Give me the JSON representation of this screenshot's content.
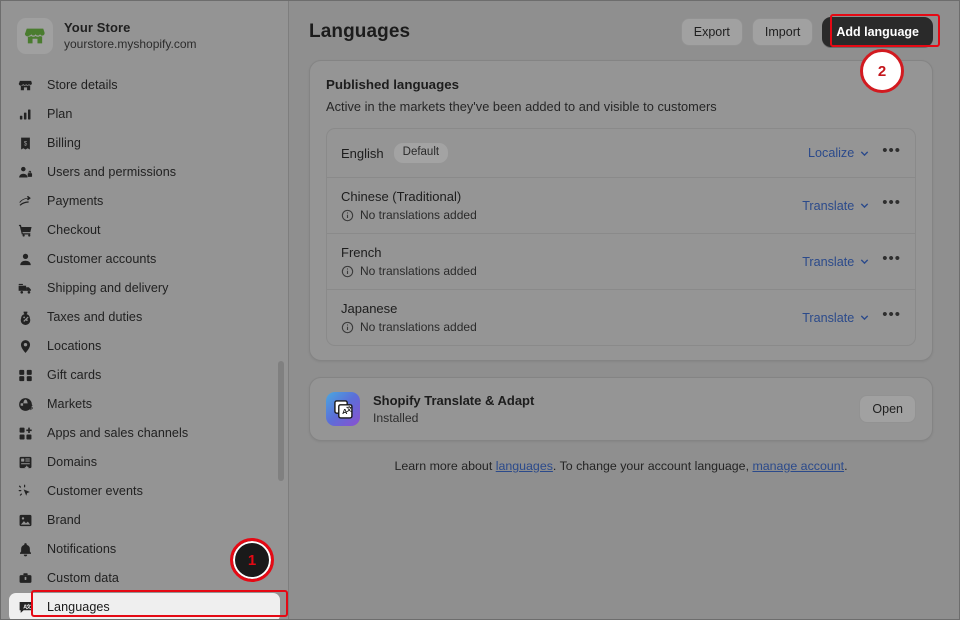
{
  "sidebar": {
    "store": {
      "name": "Your Store",
      "domain": "yourstore.myshopify.com",
      "logo_icon": "storefront-icon"
    },
    "items": [
      {
        "label": "Store details",
        "icon": "storefront-icon",
        "selected": false
      },
      {
        "label": "Plan",
        "icon": "chart-bars-icon",
        "selected": false
      },
      {
        "label": "Billing",
        "icon": "receipt-dollar-icon",
        "selected": false
      },
      {
        "label": "Users and permissions",
        "icon": "users-lock-icon",
        "selected": false
      },
      {
        "label": "Payments",
        "icon": "payment-card-icon",
        "selected": false
      },
      {
        "label": "Checkout",
        "icon": "shopping-cart-icon",
        "selected": false
      },
      {
        "label": "Customer accounts",
        "icon": "person-icon",
        "selected": false
      },
      {
        "label": "Shipping and delivery",
        "icon": "delivery-truck-icon",
        "selected": false
      },
      {
        "label": "Taxes and duties",
        "icon": "tax-tag-icon",
        "selected": false
      },
      {
        "label": "Locations",
        "icon": "map-pin-icon",
        "selected": false
      },
      {
        "label": "Gift cards",
        "icon": "gift-card-icon",
        "selected": false
      },
      {
        "label": "Markets",
        "icon": "globe-dollar-icon",
        "selected": false
      },
      {
        "label": "Apps and sales channels",
        "icon": "apps-grid-plus-icon",
        "selected": false
      },
      {
        "label": "Domains",
        "icon": "domain-icon",
        "selected": false
      },
      {
        "label": "Customer events",
        "icon": "cursor-click-icon",
        "selected": false
      },
      {
        "label": "Brand",
        "icon": "image-brand-icon",
        "selected": false
      },
      {
        "label": "Notifications",
        "icon": "bell-icon",
        "selected": false
      },
      {
        "label": "Custom data",
        "icon": "database-icon",
        "selected": false
      },
      {
        "label": "Languages",
        "icon": "translate-icon",
        "selected": true
      }
    ]
  },
  "header": {
    "title": "Languages",
    "export_label": "Export",
    "import_label": "Import",
    "add_language_label": "Add language"
  },
  "published": {
    "title": "Published languages",
    "subtitle": "Active in the markets they've been added to and visible to customers",
    "rows": [
      {
        "name": "English",
        "badge": "Default",
        "status": "",
        "action": "Localize",
        "has_info": false,
        "menu": "•••"
      },
      {
        "name": "Chinese (Traditional)",
        "badge": "",
        "status": "No translations added",
        "action": "Translate",
        "has_info": true,
        "menu": "•••"
      },
      {
        "name": "French",
        "badge": "",
        "status": "No translations added",
        "action": "Translate",
        "has_info": true,
        "menu": "•••"
      },
      {
        "name": "Japanese",
        "badge": "",
        "status": "No translations added",
        "action": "Translate",
        "has_info": true,
        "menu": "•••"
      }
    ]
  },
  "app": {
    "name": "Shopify Translate & Adapt",
    "state": "Installed",
    "open_label": "Open",
    "icon": "translate-app-icon"
  },
  "footnote": {
    "part1": "Learn more about ",
    "link1": "languages",
    "part2": ". To change your account language, ",
    "link2": "manage account",
    "part3": "."
  },
  "annotations": [
    {
      "number": "1",
      "style": "dark",
      "target": "sidebar-item-languages"
    },
    {
      "number": "2",
      "style": "light",
      "target": "add-language-button"
    }
  ],
  "colors": {
    "accent_link": "#2b4a8b",
    "annotation_red": "#e50914",
    "primary_button": "#2a2a2a"
  }
}
